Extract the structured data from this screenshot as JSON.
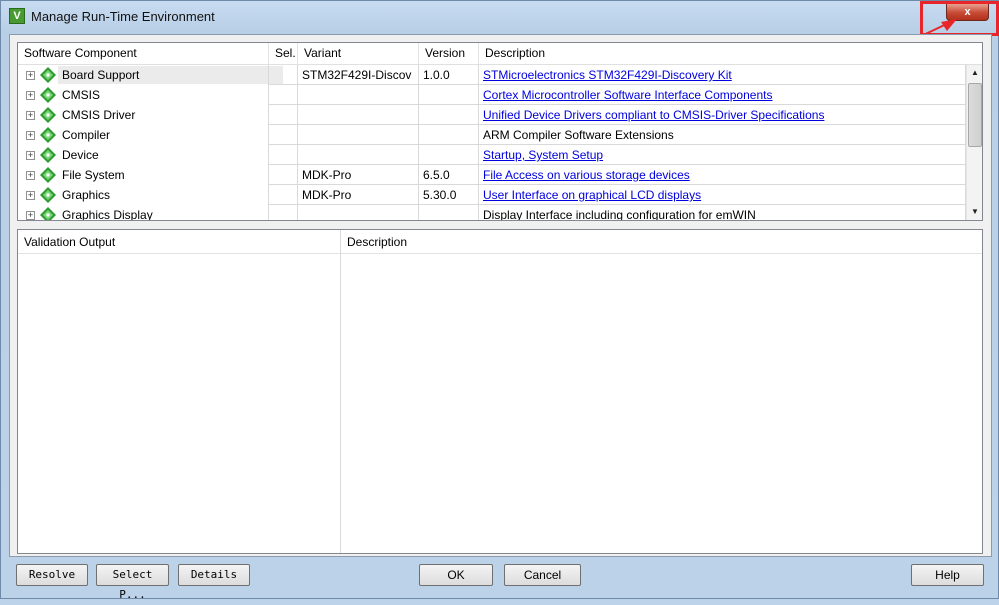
{
  "window": {
    "title": "Manage Run-Time Environment",
    "close_label": "x"
  },
  "grid": {
    "headers": {
      "component": "Software Component",
      "sel": "Sel.",
      "variant": "Variant",
      "version": "Version",
      "description": "Description"
    },
    "rows": [
      {
        "component": "Board Support",
        "variant": "STM32F429I-Discov",
        "version": "1.0.0",
        "description": "STMicroelectronics STM32F429I-Discovery Kit",
        "link": true
      },
      {
        "component": "CMSIS",
        "variant": "",
        "version": "",
        "description": "Cortex Microcontroller Software Interface Components",
        "link": true
      },
      {
        "component": "CMSIS Driver",
        "variant": "",
        "version": "",
        "description": "Unified Device Drivers compliant to CMSIS-Driver Specifications",
        "link": true
      },
      {
        "component": "Compiler",
        "variant": "",
        "version": "",
        "description": "ARM Compiler Software Extensions",
        "link": false
      },
      {
        "component": "Device",
        "variant": "",
        "version": "",
        "description": "Startup, System Setup",
        "link": true
      },
      {
        "component": "File System",
        "variant": "MDK-Pro",
        "version": "6.5.0",
        "description": "File Access on various storage devices",
        "link": true
      },
      {
        "component": "Graphics",
        "variant": "MDK-Pro",
        "version": "5.30.0",
        "description": "User Interface on graphical LCD displays",
        "link": true
      },
      {
        "component": "Graphics Display",
        "variant": "",
        "version": "",
        "description": "Display Interface including configuration for emWIN",
        "link": false
      }
    ]
  },
  "validation": {
    "headers": {
      "output": "Validation Output",
      "description": "Description"
    }
  },
  "buttons": {
    "resolve": "Resolve",
    "select": "Select P...",
    "details": "Details",
    "ok": "OK",
    "cancel": "Cancel",
    "help": "Help"
  },
  "colors": {
    "link": "#0000e0",
    "highlight": "#e8262a",
    "gem": "#2e9c2e"
  }
}
